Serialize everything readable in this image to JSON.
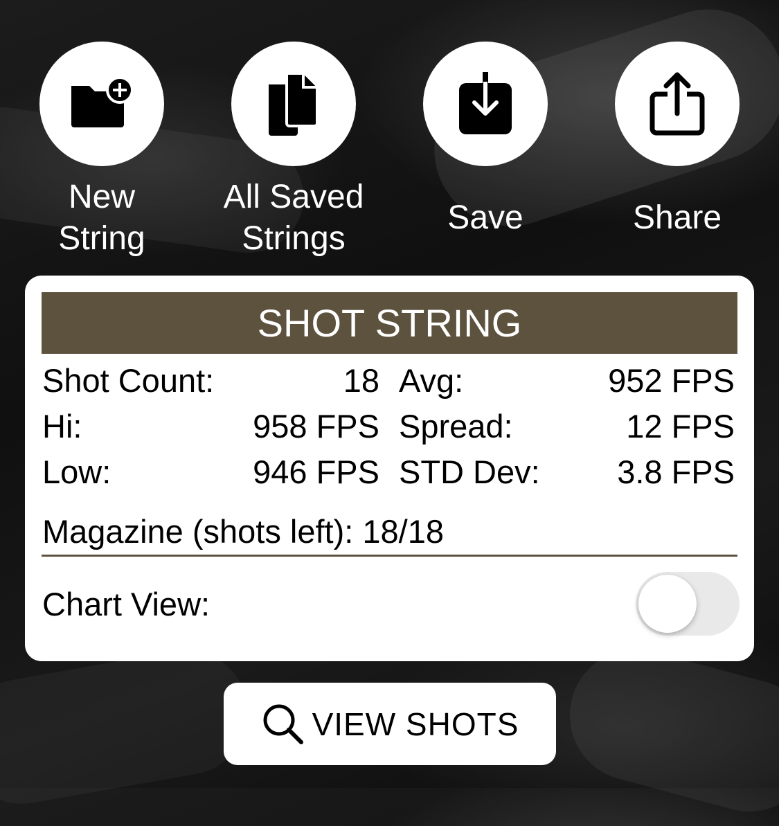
{
  "actions": [
    {
      "label_line1": "New",
      "label_line2": "String",
      "icon": "folder-plus-icon"
    },
    {
      "label_line1": "All Saved",
      "label_line2": "Strings",
      "icon": "documents-icon"
    },
    {
      "label_line1": "Save",
      "label_line2": "",
      "icon": "download-icon"
    },
    {
      "label_line1": "Share",
      "label_line2": "",
      "icon": "share-icon"
    }
  ],
  "card": {
    "title": "SHOT STRING",
    "stats": {
      "shot_count_label": "Shot Count:",
      "shot_count_value": "18",
      "avg_label": "Avg:",
      "avg_value": "952 FPS",
      "hi_label": "Hi:",
      "hi_value": "958 FPS",
      "spread_label": "Spread:",
      "spread_value": "12 FPS",
      "low_label": "Low:",
      "low_value": "946 FPS",
      "std_dev_label": "STD Dev:",
      "std_dev_value": "3.8 FPS"
    },
    "magazine": "Magazine (shots left): 18/18",
    "chart_view_label": "Chart View:",
    "chart_view_enabled": false
  },
  "view_shots": {
    "label": "VIEW SHOTS",
    "icon": "search-icon"
  },
  "colors": {
    "banner": "#5d523e",
    "toggle_off": "#e9e9ea"
  }
}
